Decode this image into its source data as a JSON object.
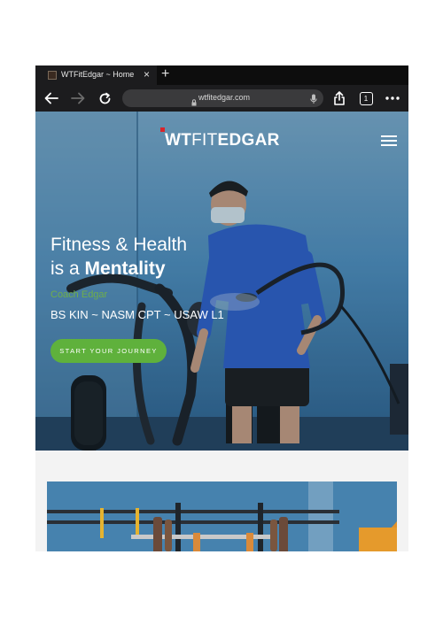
{
  "browser": {
    "tab": {
      "title": "WTFitEdgar ~ Home"
    },
    "url": "wtfitedgar.com",
    "tab_count": "1"
  },
  "site": {
    "logo": {
      "part1": "WT",
      "part2": "FIT",
      "part3": "EDGAR"
    },
    "hero": {
      "headline_line1": "Fitness & Health",
      "headline_line2_prefix": "is a ",
      "headline_line2_bold": "Mentality",
      "byline": "Coach Edgar",
      "credentials": "BS KIN ~ NASM CPT ~ USAW L1",
      "cta_label": "START YOUR JOURNEY"
    }
  },
  "colors": {
    "accent_green": "#5fb13c",
    "logo_red": "#d9242b",
    "browser_chrome": "#1c1c1e"
  }
}
